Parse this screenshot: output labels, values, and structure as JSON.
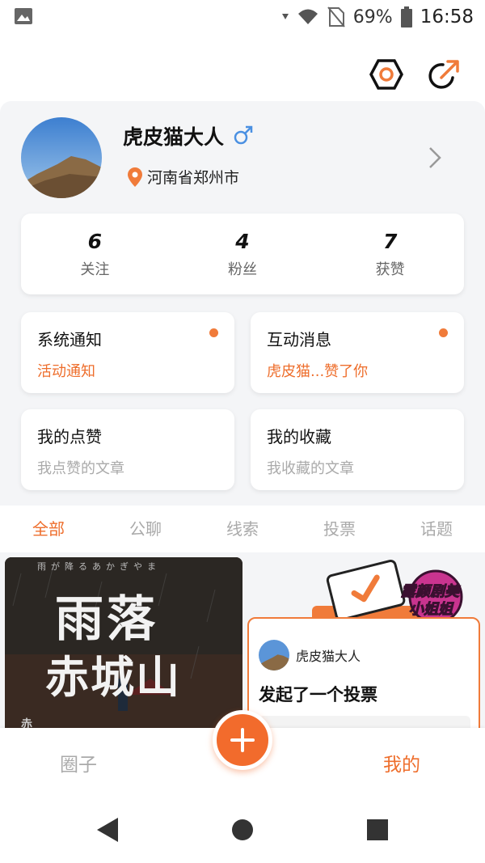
{
  "status_bar": {
    "battery": "69%",
    "time": "16:58"
  },
  "profile": {
    "username": "虎皮猫大人",
    "location": "河南省郑州市"
  },
  "stats": [
    {
      "value": "6",
      "label": "关注"
    },
    {
      "value": "4",
      "label": "粉丝"
    },
    {
      "value": "7",
      "label": "获赞"
    }
  ],
  "tiles": {
    "system": {
      "title": "系统通知",
      "subtitle": "活动通知"
    },
    "interact": {
      "title": "互动消息",
      "subtitle": "虎皮猫...赞了你"
    },
    "likes": {
      "title": "我的点赞",
      "subtitle": "我点赞的文章"
    },
    "favorites": {
      "title": "我的收藏",
      "subtitle": "我收藏的文章"
    }
  },
  "tabs": [
    "全部",
    "公聊",
    "线索",
    "投票",
    "话题"
  ],
  "feed": {
    "poster": {
      "title_line1": "雨落",
      "title_line2": "赤城山",
      "top_line": "雨が降るあかぎやま",
      "side_text": "赤"
    },
    "vote_card": {
      "author": "虎皮猫大人",
      "title": "发起了一个投票"
    },
    "badge_text": [
      "露颜剧美",
      "小姐姐"
    ]
  },
  "bottom_nav": {
    "left": "圈子",
    "right": "我的"
  },
  "colors": {
    "accent": "#ee6e2c",
    "background": "#f4f5f7"
  },
  "icons": {
    "settings": "settings-hexagon-icon",
    "share": "share-arrow-icon",
    "gender": "male-icon",
    "location": "location-pin-icon",
    "add": "plus-icon"
  }
}
